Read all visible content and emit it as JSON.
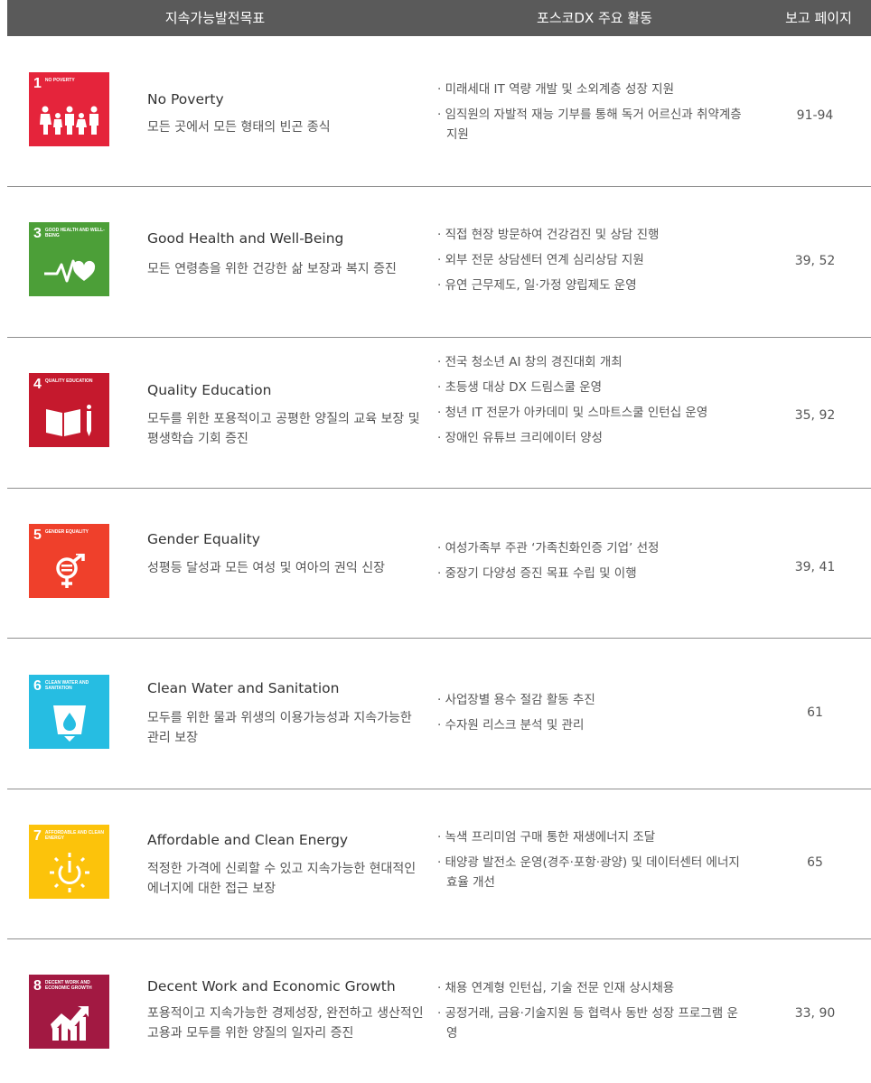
{
  "header": {
    "goal_label": "지속가능발전목표",
    "activity_label": "포스코DX 주요 활동",
    "page_label": "보고 페이지"
  },
  "rows": [
    {
      "icon": {
        "number": "1",
        "title": "NO POVERTY",
        "color": "#e5243b",
        "symbol": "family-icon"
      },
      "goal_en": "No Poverty",
      "goal_ko": "모든 곳에서 모든 형태의 빈곤 종식",
      "activities": [
        "· 미래세대 IT 역량 개발 및 소외계층 성장 지원",
        "· 임직원의 자발적 재능 기부를 통해 독거 어르신과 취약계층 지원"
      ],
      "pages": "91-94"
    },
    {
      "icon": {
        "number": "3",
        "title": "GOOD HEALTH AND WELL-BEING",
        "color": "#4c9f38",
        "symbol": "heartbeat-icon"
      },
      "goal_en": "Good Health and Well-Being",
      "goal_ko": "모든 연령층을 위한 건강한 삶 보장과 복지 증진",
      "activities": [
        "· 직접 현장 방문하여 건강검진 및 상담 진행",
        "· 외부 전문 상담센터 연계 심리상담 지원",
        "· 유연 근무제도, 일·가정 양립제도 운영"
      ],
      "pages": "39, 52"
    },
    {
      "icon": {
        "number": "4",
        "title": "QUALITY EDUCATION",
        "color": "#c5192d",
        "symbol": "book-pencil-icon"
      },
      "goal_en": "Quality Education",
      "goal_ko": "모두를 위한 포용적이고 공평한 양질의 교육 보장 및 평생학습 기회 증진",
      "activities": [
        "· 전국 청소년 AI 창의 경진대회 개최",
        "· 초등생 대상 DX 드림스쿨 운영",
        "· 청년 IT 전문가 아카데미 및 스마트스쿨 인턴십 운영",
        "· 장애인 유튜브 크리에이터 양성"
      ],
      "pages": "35, 92"
    },
    {
      "icon": {
        "number": "5",
        "title": "GENDER EQUALITY",
        "color": "#ef402b",
        "symbol": "gender-equality-icon"
      },
      "goal_en": "Gender Equality",
      "goal_ko": "성평등 달성과 모든 여성 및 여아의 권익 신장",
      "activities": [
        "· 여성가족부 주관 ‘가족친화인증 기업’ 선정",
        "· 중장기 다양성 증진 목표 수립 및 이행"
      ],
      "pages": "39, 41"
    },
    {
      "icon": {
        "number": "6",
        "title": "CLEAN WATER AND SANITATION",
        "color": "#26bde2",
        "symbol": "water-glass-icon"
      },
      "goal_en": "Clean Water and Sanitation",
      "goal_ko": "모두를 위한 물과 위생의 이용가능성과 지속가능한 관리 보장",
      "activities": [
        "· 사업장별 용수 절감 활동 추진",
        "· 수자원 리스크 분석 및 관리"
      ],
      "pages": "61"
    },
    {
      "icon": {
        "number": "7",
        "title": "AFFORDABLE AND CLEAN ENERGY",
        "color": "#fcc30b",
        "symbol": "power-sun-icon"
      },
      "goal_en": "Affordable and Clean Energy",
      "goal_ko": "적정한 가격에 신뢰할 수 있고 지속가능한 현대적인 에너지에 대한 접근 보장",
      "activities": [
        "· 녹색 프리미엄 구매 통한 재생에너지 조달",
        "· 태양광 발전소 운영(경주·포항·광양) 및 데이터센터 에너지 효율 개선"
      ],
      "pages": "65"
    },
    {
      "icon": {
        "number": "8",
        "title": "DECENT WORK AND ECONOMIC GROWTH",
        "color": "#a21942",
        "symbol": "growth-chart-icon"
      },
      "goal_en": "Decent Work and Economic Growth",
      "goal_ko": "포용적이고 지속가능한 경제성장, 완전하고 생산적인 고용과 모두를 위한 양질의 일자리 증진",
      "activities": [
        "· 채용 연계형 인턴십, 기술 전문 인재 상시채용",
        "· 공정거래, 금융·기술지원 등 협력사 동반 성장 프로그램 운영"
      ],
      "pages": "33, 90"
    }
  ]
}
